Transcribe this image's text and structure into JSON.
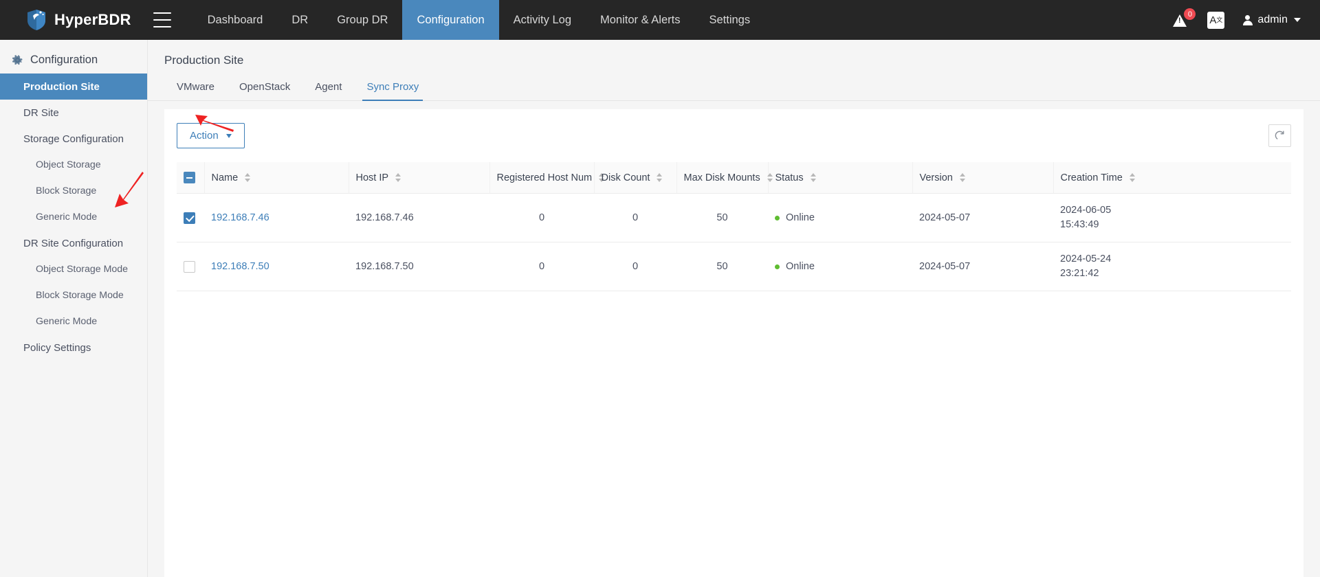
{
  "navbar": {
    "brand": "HyperBDR",
    "menu_icon": "hamburger-icon",
    "links": [
      {
        "label": "Dashboard",
        "active": false
      },
      {
        "label": "DR",
        "active": false
      },
      {
        "label": "Group DR",
        "active": false
      },
      {
        "label": "Configuration",
        "active": true
      },
      {
        "label": "Activity Log",
        "active": false
      },
      {
        "label": "Monitor & Alerts",
        "active": false
      },
      {
        "label": "Settings",
        "active": false
      }
    ],
    "alert_badge": "0",
    "alert_icon": "warning-triangle-icon",
    "language_icon": "language-translate-icon",
    "language_label": "A",
    "language_sup": "文",
    "user_name": "admin",
    "user_icon": "user-avatar-icon"
  },
  "sidebar": {
    "title": "Configuration",
    "title_icon": "gear-icon",
    "items": [
      {
        "label": "Production Site",
        "active": true,
        "sub": false
      },
      {
        "label": "DR Site",
        "active": false,
        "sub": false
      },
      {
        "label": "Storage Configuration",
        "active": false,
        "sub": false
      },
      {
        "label": "Object Storage",
        "active": false,
        "sub": true
      },
      {
        "label": "Block Storage",
        "active": false,
        "sub": true
      },
      {
        "label": "Generic Mode",
        "active": false,
        "sub": true
      },
      {
        "label": "DR Site Configuration",
        "active": false,
        "sub": false
      },
      {
        "label": "Object Storage Mode",
        "active": false,
        "sub": true
      },
      {
        "label": "Block Storage Mode",
        "active": false,
        "sub": true
      },
      {
        "label": "Generic Mode",
        "active": false,
        "sub": true
      },
      {
        "label": "Policy Settings",
        "active": false,
        "sub": false
      }
    ]
  },
  "main": {
    "page_title": "Production Site",
    "tabs": [
      {
        "label": "VMware",
        "active": false
      },
      {
        "label": "OpenStack",
        "active": false
      },
      {
        "label": "Agent",
        "active": false
      },
      {
        "label": "Sync Proxy",
        "active": true
      }
    ],
    "toolbar": {
      "action_label": "Action",
      "action_caret_icon": "chevron-down-icon",
      "refresh_icon": "refresh-icon"
    },
    "table": {
      "select_all_state": "indeterminate",
      "columns": [
        {
          "label": "Name",
          "sortable": true
        },
        {
          "label": "Host IP",
          "sortable": true
        },
        {
          "label": "Registered Host Num",
          "sortable": true
        },
        {
          "label": "Disk Count",
          "sortable": true
        },
        {
          "label": "Max Disk Mounts",
          "sortable": true
        },
        {
          "label": "Status",
          "sortable": true
        },
        {
          "label": "Version",
          "sortable": true
        },
        {
          "label": "Creation Time",
          "sortable": true
        }
      ],
      "rows": [
        {
          "selected": true,
          "name": "192.168.7.46",
          "host_ip": "192.168.7.46",
          "registered_host_num": "0",
          "disk_count": "0",
          "max_disk_mounts": "50",
          "status": "Online",
          "status_color": "#5fbd32",
          "version": "2024-05-07",
          "creation_date": "2024-06-05",
          "creation_time": "15:43:49"
        },
        {
          "selected": false,
          "name": "192.168.7.50",
          "host_ip": "192.168.7.50",
          "registered_host_num": "0",
          "disk_count": "0",
          "max_disk_mounts": "50",
          "status": "Online",
          "status_color": "#5fbd32",
          "version": "2024-05-07",
          "creation_date": "2024-05-24",
          "creation_time": "23:21:42"
        }
      ]
    }
  },
  "annotations": {
    "arrow_color": "#ee2222",
    "arrow_action_target": "action-button",
    "arrow_row_target": "row-1-checkbox"
  },
  "colors": {
    "navbar_bg": "#262626",
    "accent": "#3d7eb8",
    "active_nav": "#4a88bd",
    "sidebar_bg": "#f5f5f5",
    "status_online": "#5fbd32",
    "badge_red": "#ef4a52"
  }
}
